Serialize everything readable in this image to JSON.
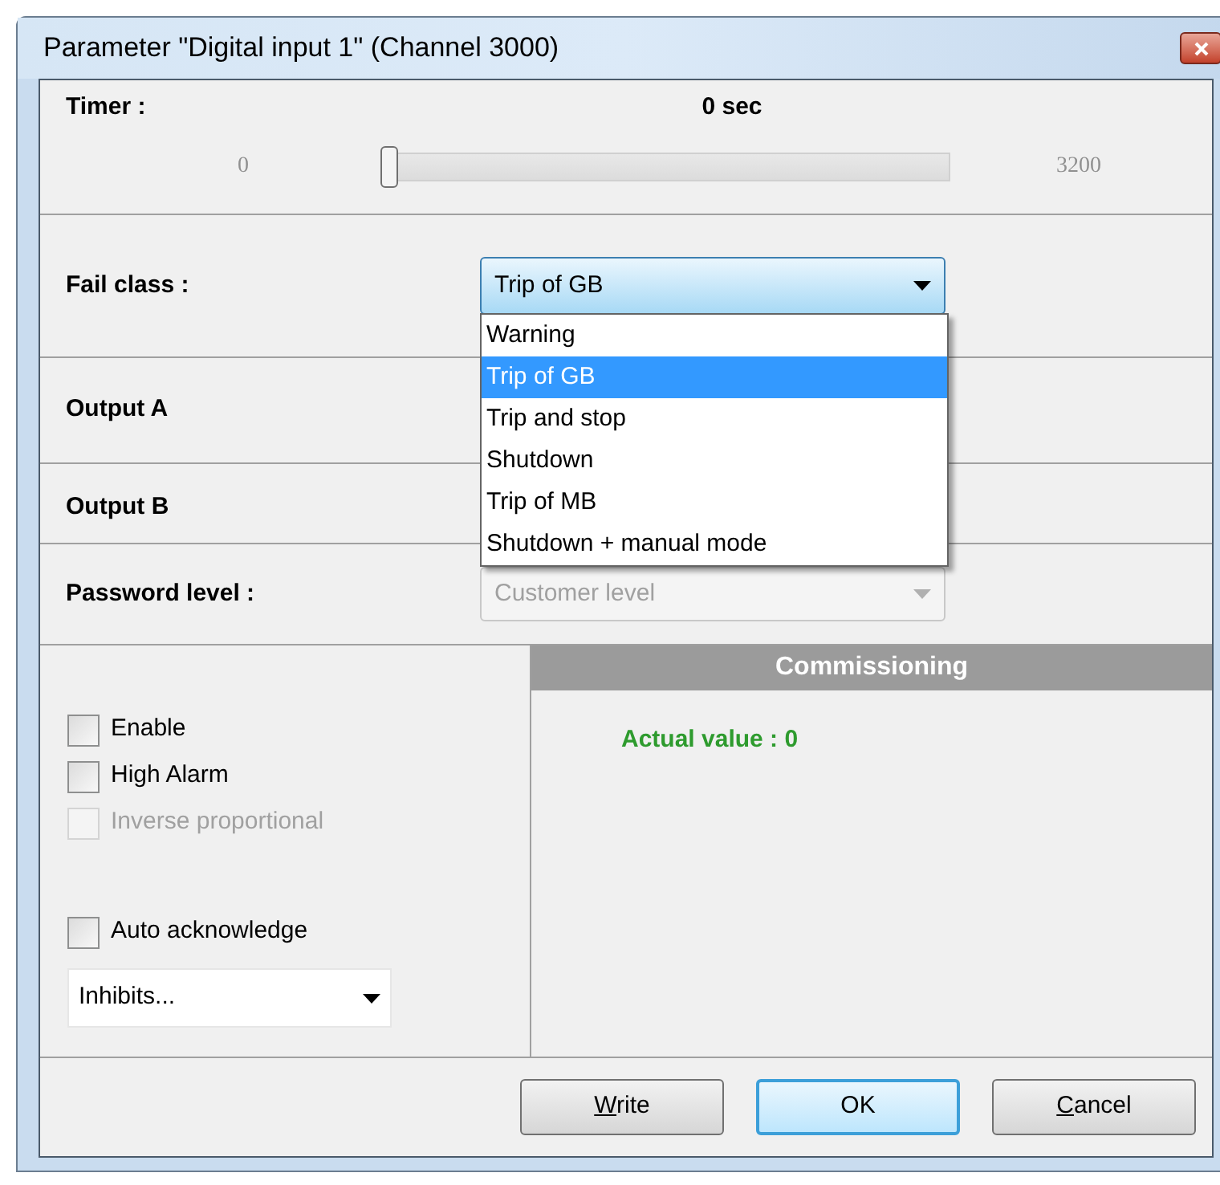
{
  "window": {
    "title": "Parameter \"Digital input 1\" (Channel 3000)"
  },
  "timer": {
    "label": "Timer :",
    "value": "0 sec",
    "min": "0",
    "max": "3200",
    "level": 0
  },
  "fail_class": {
    "label": "Fail class :",
    "value": "Trip of GB",
    "expanded": true,
    "options": [
      {
        "label": "Warning",
        "selected": false
      },
      {
        "label": "Trip of GB",
        "selected": true
      },
      {
        "label": "Trip and stop",
        "selected": false
      },
      {
        "label": "Shutdown",
        "selected": false
      },
      {
        "label": "Trip of MB",
        "selected": false
      },
      {
        "label": "Shutdown + manual mode",
        "selected": false
      }
    ]
  },
  "outputs": [
    {
      "label": "Output A"
    },
    {
      "label": "Output B"
    }
  ],
  "password_level": {
    "label": "Password level :",
    "value": "Customer level",
    "disabled": true
  },
  "checkboxes": [
    {
      "label": "Enable",
      "checked": false,
      "disabled": false
    },
    {
      "label": "High Alarm",
      "checked": false,
      "disabled": false
    },
    {
      "label": "Inverse proportional",
      "checked": false,
      "disabled": true
    },
    {
      "label": "Auto acknowledge",
      "checked": false,
      "disabled": false
    }
  ],
  "inhibits": {
    "value": "Inhibits..."
  },
  "commissioning": {
    "title": "Commissioning",
    "actual_value": "Actual value : 0"
  },
  "buttons": [
    {
      "label": "Write",
      "default": false,
      "underline_first": true
    },
    {
      "label": "OK",
      "default": true,
      "underline_first": false
    },
    {
      "label": "Cancel",
      "default": false,
      "underline_first": true
    }
  ]
}
